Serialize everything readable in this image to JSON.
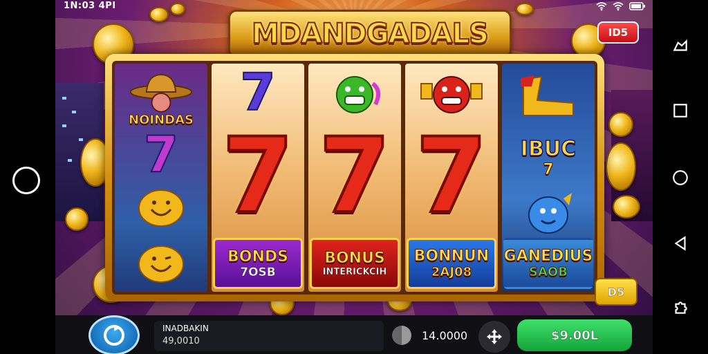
{
  "status_bar": {
    "time": "1N:03 4PI"
  },
  "game": {
    "title": "MDANDGADALS",
    "top_badge": "ID5",
    "bottom_right_badge": "D5",
    "reels": {
      "reel1": {
        "top_label": "NOINDAS",
        "seven": "7"
      },
      "reel2": {
        "top_seven": "7",
        "big_seven": "7",
        "bonus_label": "BONDS",
        "bonus_value": "7OSB"
      },
      "reel3": {
        "big_seven": "7",
        "bonus_label": "BONUS",
        "bonus_value": "INTERICKCIH"
      },
      "reel4": {
        "big_seven": "7",
        "bonus_label": "BONNUN",
        "bonus_value": "2AJ08"
      },
      "reel5": {
        "mid_label": "IBUC",
        "mid_sub": "7",
        "bonus_label": "GANEDIUS",
        "bonus_value": "SAOB"
      }
    }
  },
  "bottom_bar": {
    "info_title": "INADBAKIN",
    "info_value": "49,0010",
    "bet_value": "14.0000",
    "balance_button": "$9.00L"
  },
  "colors": {
    "accent_gold": "#ffd84a",
    "spin_blue": "#1c7fd6",
    "balance_green": "#22c04c",
    "badge_red": "#d51a1e"
  }
}
